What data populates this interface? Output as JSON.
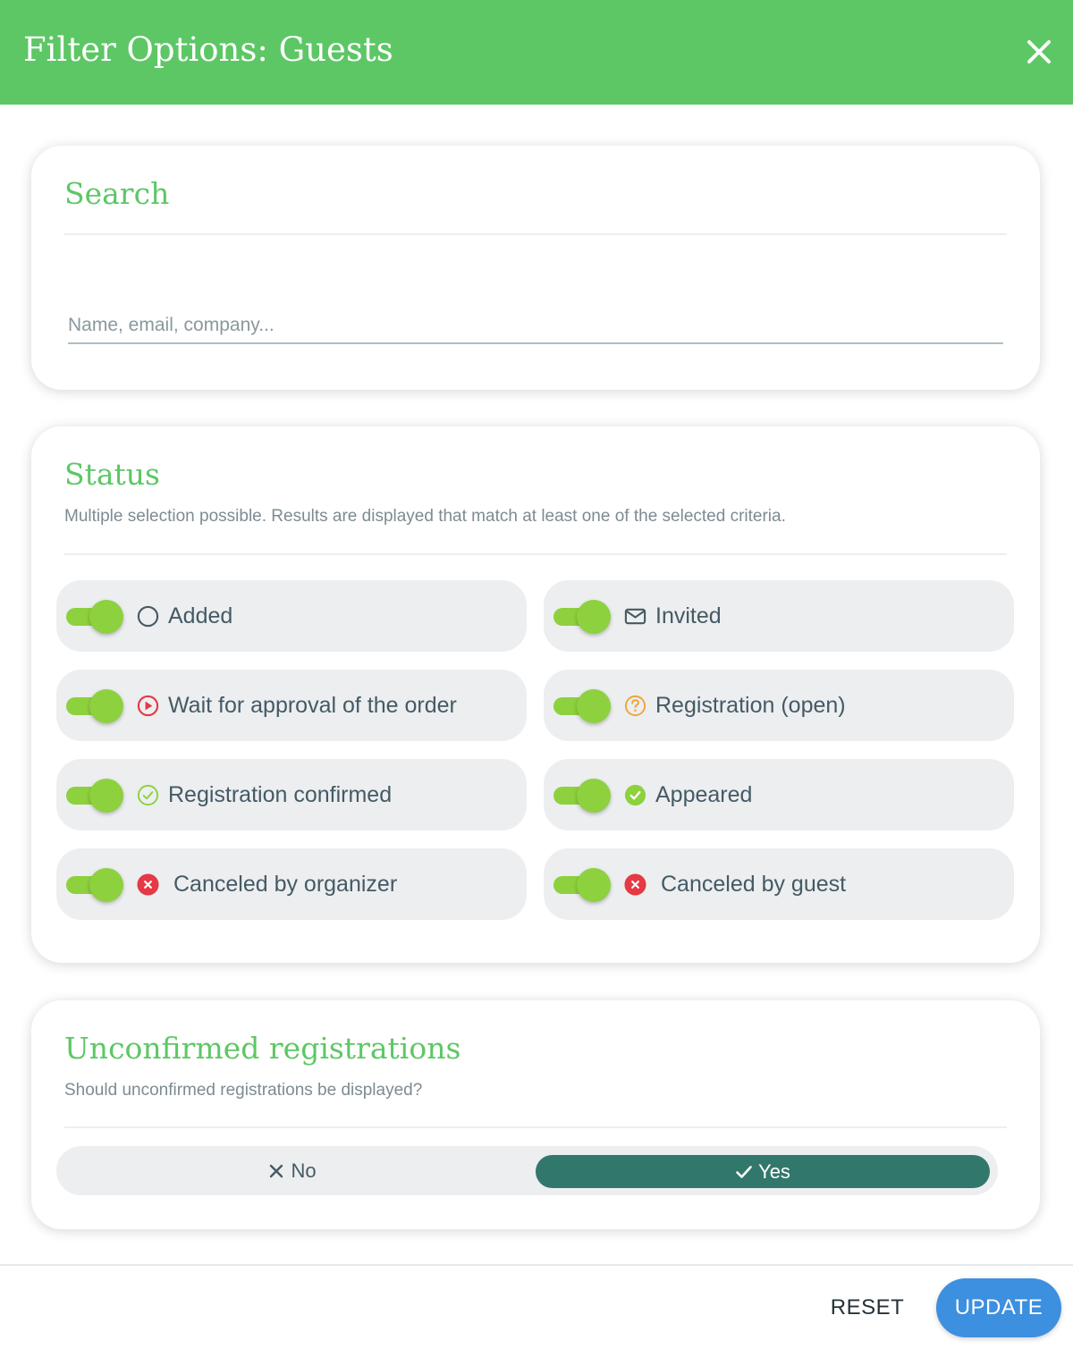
{
  "header": {
    "title": "Filter Options: Guests",
    "close_icon": "close-icon"
  },
  "search": {
    "title": "Search",
    "placeholder": "Name, email, company...",
    "value": ""
  },
  "status": {
    "title": "Status",
    "subtitle": "Multiple selection possible. Results are displayed that match at least one of the selected criteria.",
    "options": [
      {
        "label": "Added",
        "icon": "circle-outline-icon",
        "enabled": true
      },
      {
        "label": "Invited",
        "icon": "envelope-icon",
        "enabled": true
      },
      {
        "label": "Wait for approval of the order",
        "icon": "play-circle-icon",
        "enabled": true
      },
      {
        "label": "Registration (open)",
        "icon": "question-circle-icon",
        "enabled": true
      },
      {
        "label": "Registration confirmed",
        "icon": "check-circle-outline-icon",
        "enabled": true
      },
      {
        "label": "Appeared",
        "icon": "check-circle-filled-icon",
        "enabled": true
      },
      {
        "label": "Canceled by organizer",
        "icon": "x-circle-icon",
        "enabled": true
      },
      {
        "label": "Canceled by guest",
        "icon": "x-circle-icon",
        "enabled": true
      }
    ]
  },
  "unconfirmed": {
    "title": "Unconfirmed registrations",
    "subtitle": "Should unconfirmed registrations be displayed?",
    "no_label": "No",
    "yes_label": "Yes",
    "selected": "Yes"
  },
  "footer": {
    "reset_label": "RESET",
    "update_label": "UPDATE"
  },
  "colors": {
    "header": "#5dc765",
    "accent_title": "#5dc765",
    "toggle_on": "#8dd13e",
    "segment_selected": "#32776b",
    "update_button": "#3d8fe0",
    "cancel_icon": "#e53945",
    "pending_icon": "#f0a537"
  }
}
